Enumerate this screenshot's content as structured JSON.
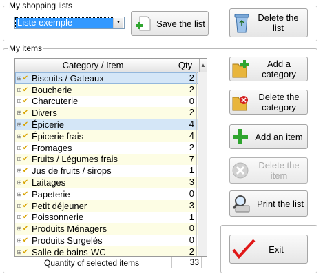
{
  "lists_group": {
    "title": "My shopping lists",
    "selected_list": "Liste exemple",
    "save_label": "Save the list",
    "delete_label": "Delete the list"
  },
  "items_group": {
    "title": "My items",
    "columns": {
      "category": "Category / Item",
      "qty": "Qty"
    },
    "rows": [
      {
        "name": "Biscuits / Gateaux",
        "qty": "2"
      },
      {
        "name": "Boucherie",
        "qty": "2"
      },
      {
        "name": "Charcuterie",
        "qty": "0"
      },
      {
        "name": "Divers",
        "qty": "2"
      },
      {
        "name": "Épicerie",
        "qty": "4"
      },
      {
        "name": "Épicerie frais",
        "qty": "4"
      },
      {
        "name": "Fromages",
        "qty": "2"
      },
      {
        "name": "Fruits / Légumes frais",
        "qty": "7"
      },
      {
        "name": "Jus de fruits / sirops",
        "qty": "1"
      },
      {
        "name": "Laitages",
        "qty": "3"
      },
      {
        "name": "Papeterie",
        "qty": "0"
      },
      {
        "name": "Petit déjeuner",
        "qty": "3"
      },
      {
        "name": "Poissonnerie",
        "qty": "1"
      },
      {
        "name": "Produits Ménagers",
        "qty": "0"
      },
      {
        "name": "Produits Surgelés",
        "qty": "0"
      },
      {
        "name": "Salle de bains-WC",
        "qty": "2"
      }
    ],
    "total_label": "Quantity of selected items",
    "total_value": "33"
  },
  "actions": {
    "add_category": "Add a category",
    "delete_category": "Delete the category",
    "add_item": "Add an item",
    "delete_item": "Delete the item",
    "print_list": "Print the list",
    "exit": "Exit"
  },
  "colors": {
    "selection": "#3399ff",
    "row_alt": "#fdfde4",
    "row_selected": "#d4e6f7",
    "green_plus": "#2fa52f",
    "red_x": "#d42020"
  }
}
